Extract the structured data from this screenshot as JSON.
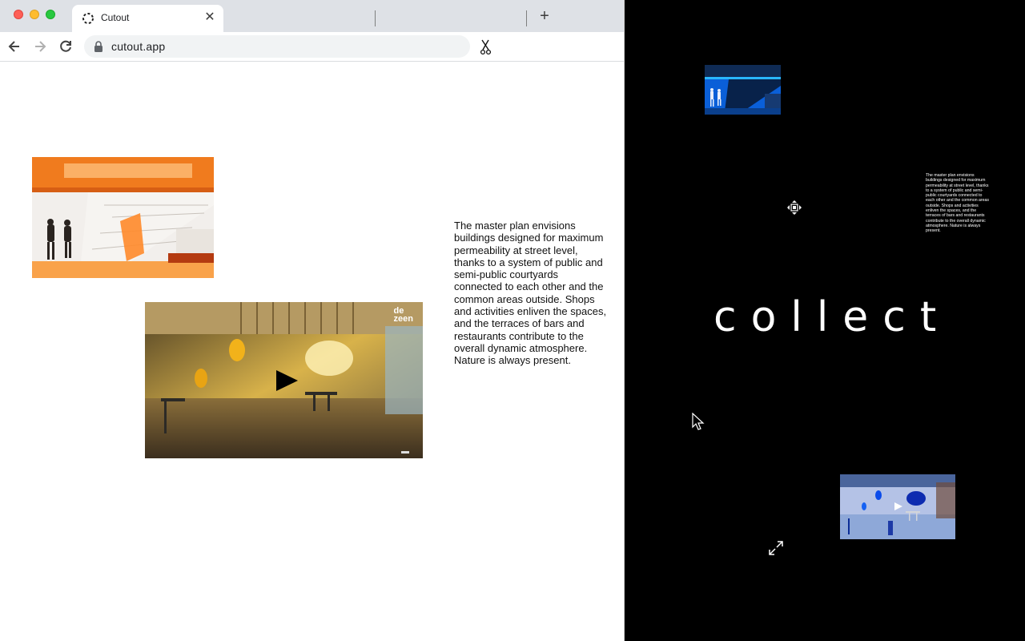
{
  "browser": {
    "tab": {
      "title": "Cutout",
      "close_glyph": "✕"
    },
    "new_tab_glyph": "+",
    "toolbar": {
      "back_icon": "arrow-left-icon",
      "forward_icon": "arrow-right-icon",
      "reload_icon": "reload-icon",
      "url": "cutout.app",
      "extension_icon": "scissors-icon"
    }
  },
  "page": {
    "photo_alt": "orange staircase atrium",
    "video": {
      "watermark": "de\nzeen",
      "play_icon": "play-icon"
    },
    "paragraph": "The master plan envisions buildings designed for maximum permeability at street level, thanks to a system of public and semi-public courtyards connected to each other and the common areas outside. Shops and activities enliven the spaces, and the terraces of bars and restaurants contribute to the overall dynamic atmosphere. Nature is always present."
  },
  "canvas": {
    "heading": "collect",
    "mini_text": "The master plan envisions buildings designed for maximum permeability at street level, thanks to a system of public and semi-public courtyards connected to each other and the common areas outside. Shops and activities enliven the spaces, and the terraces of bars and restaurants contribute to the overall dynamic atmosphere. Nature is always present.",
    "icons": [
      "move-icon",
      "expand-icon",
      "cursor-icon"
    ]
  },
  "colors": {
    "canvas_bg": "#000000",
    "accent_orange": "#f07b1e",
    "inverted_blue": "#2f6fe0"
  }
}
